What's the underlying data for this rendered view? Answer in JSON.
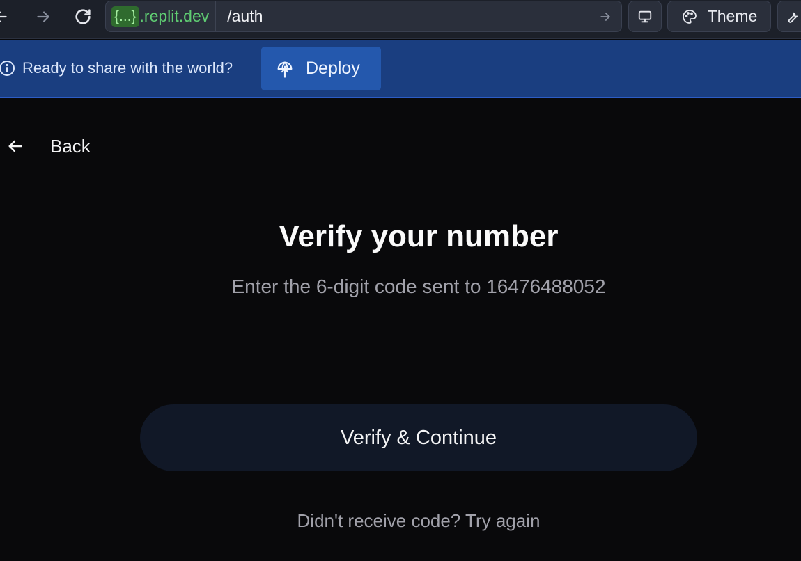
{
  "browser": {
    "url_host_badge": "{...}",
    "url_host_suffix": ".replit.dev",
    "url_path": "/auth",
    "theme_label": "Theme"
  },
  "banner": {
    "message": "Ready to share with the world?",
    "deploy_label": "Deploy"
  },
  "page": {
    "back_label": "Back",
    "title": "Verify your number",
    "subtitle": "Enter the 6-digit code sent to 16476488052",
    "verify_button": "Verify & Continue",
    "resend_text": "Didn't receive code? Try again"
  },
  "icons": [
    "back-arrow-icon",
    "forward-arrow-icon",
    "reload-icon",
    "go-arrow-icon",
    "monitor-icon",
    "palette-icon",
    "wrench-icon",
    "info-icon",
    "deploy-globe-icon",
    "back-arrow-icon"
  ],
  "colors": {
    "background": "#09090b",
    "toolbar": "#1c2029",
    "banner": "#1a3e80",
    "deploy_button": "#2458ad",
    "primary_button": "#111827",
    "url_host": "#5fcc72"
  }
}
